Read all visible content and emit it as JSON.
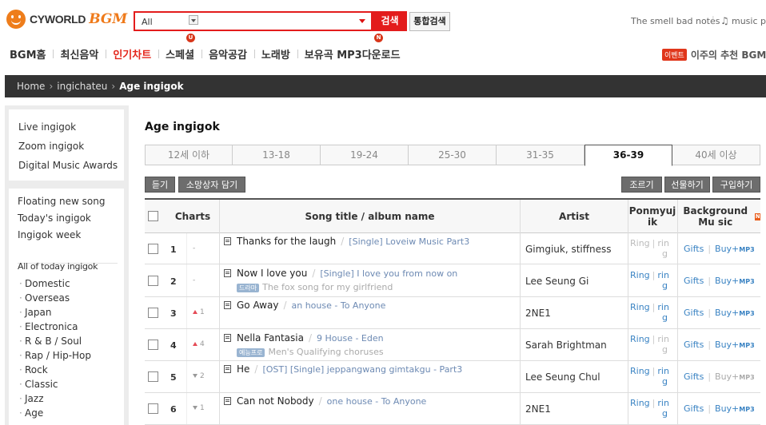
{
  "header": {
    "logo_text": "CYWORLD",
    "logo_brand": "BGM",
    "search": {
      "category": "All",
      "value": "",
      "button": "검색",
      "unified_button": "통합검색",
      "badge_u": "U",
      "badge_n": "N"
    },
    "topright_text": "The smell bad notes",
    "music_text": "music play"
  },
  "nav": {
    "items": [
      "BGM홈",
      "최신음악",
      "인기차트",
      "스페셜",
      "음악공감",
      "노래방",
      "보유곡 MP3다운로드"
    ],
    "active_index": 2,
    "event_badge": "이벤트",
    "event_text": "이주의 추천 BGM"
  },
  "breadcrumb": [
    "Home",
    "ingichateu",
    "Age ingigok"
  ],
  "sidebar": {
    "group1": [
      "Live ingigok",
      "Zoom ingigok",
      "Digital Music Awards"
    ],
    "group2": [
      "Floating new song",
      "Today's ingigok",
      "Ingigok week"
    ],
    "group3_title": "All of today ingigok",
    "group3": [
      "Domestic",
      "Overseas",
      "Japan",
      "Electronica",
      "R & B / Soul",
      "Rap / Hip-Hop",
      "Rock",
      "Classic",
      "Jazz",
      "Age"
    ]
  },
  "main": {
    "title": "Age ingigok",
    "tabs": [
      "12세 이하",
      "13-18",
      "19-24",
      "25-30",
      "31-35",
      "36-39",
      "40세 이상"
    ],
    "active_tab": 5,
    "left_buttons": [
      "듣기",
      "소망상자 담기"
    ],
    "right_buttons": [
      "조르기",
      "선물하기",
      "구입하기"
    ],
    "columns": {
      "charts": "Charts",
      "song": "Song title / album name",
      "artist": "Artist",
      "ring": "Ponmyuj ik",
      "bgm": "Background Mu sic",
      "bgm_badge": "N"
    },
    "rows": [
      {
        "rank": "1",
        "change": "-",
        "dir": "none",
        "title": "Thanks for the laugh",
        "album": "[Single] Loveiw Music Part3",
        "tag": "",
        "subtitle": "",
        "artist": "Gimgiuk, stiffness",
        "ring1": "Ring",
        "ring2": "rin",
        "ring3": "g",
        "ring_on": false,
        "ring2_on": false,
        "gifts": "Gifts",
        "buy": "Buy+",
        "mp3": "MP3",
        "buy_on": true
      },
      {
        "rank": "2",
        "change": "-",
        "dir": "none",
        "title": "Now I love you",
        "album": "[Single] I love you from now on",
        "tag": "드라마",
        "subtitle": "The fox song for my girlfriend",
        "artist": "Lee Seung Gi",
        "ring1": "Ring",
        "ring2": "rin",
        "ring3": "g",
        "ring_on": true,
        "ring2_on": true,
        "gifts": "Gifts",
        "buy": "Buy+",
        "mp3": "MP3",
        "buy_on": true
      },
      {
        "rank": "3",
        "change": "1",
        "dir": "up",
        "title": "Go Away",
        "album": "an house - To Anyone",
        "tag": "",
        "subtitle": "",
        "artist": "2NE1",
        "ring1": "Ring",
        "ring2": "rin",
        "ring3": "g",
        "ring_on": true,
        "ring2_on": true,
        "gifts": "Gifts",
        "buy": "Buy+",
        "mp3": "MP3",
        "buy_on": true
      },
      {
        "rank": "4",
        "change": "4",
        "dir": "up",
        "title": "Nella Fantasia",
        "album": "9 House - Eden",
        "tag": "예능프로",
        "subtitle": "Men's Qualifying choruses",
        "artist": "Sarah Brightman",
        "ring1": "Ring",
        "ring2": "rin",
        "ring3": "g",
        "ring_on": true,
        "ring2_on": false,
        "gifts": "Gifts",
        "buy": "Buy+",
        "mp3": "MP3",
        "buy_on": true
      },
      {
        "rank": "5",
        "change": "2",
        "dir": "down",
        "title": "He",
        "album": "[OST] [Single] jeppangwang gimtakgu - Part3",
        "tag": "",
        "subtitle": "",
        "artist": "Lee Seung Chul",
        "ring1": "Ring",
        "ring2": "rin",
        "ring3": "g",
        "ring_on": true,
        "ring2_on": true,
        "gifts": "Gifts",
        "buy": "Buy+",
        "mp3": "MP3",
        "buy_on": false
      },
      {
        "rank": "6",
        "change": "1",
        "dir": "down",
        "title": "Can not Nobody",
        "album": "one house - To Anyone",
        "tag": "",
        "subtitle": "",
        "artist": "2NE1",
        "ring1": "Ring",
        "ring2": "rin",
        "ring3": "g",
        "ring_on": true,
        "ring2_on": true,
        "gifts": "Gifts",
        "buy": "Buy+",
        "mp3": "MP3",
        "buy_on": true
      }
    ]
  },
  "colors": {
    "accent": "#e31c1c",
    "brand": "#ef7a1a",
    "link": "#3a83c3",
    "dark_bar": "#333333"
  }
}
